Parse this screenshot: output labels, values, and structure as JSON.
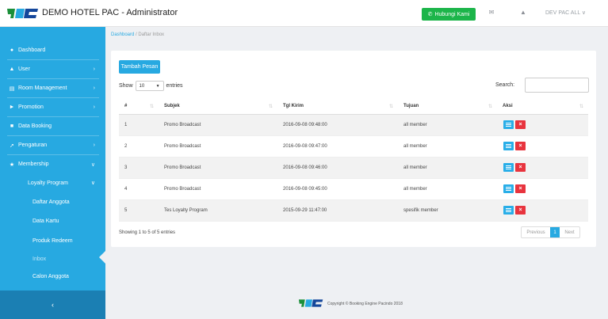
{
  "header": {
    "app_title": "DEMO HOTEL PAC - Administrator",
    "contact_label": "Hubungi Kami",
    "user_label": "DEV PAC ALL ∨"
  },
  "sidebar": {
    "items": [
      {
        "label": "Dashboard",
        "icon": "dashboard-icon",
        "chevron": ""
      },
      {
        "label": "User",
        "icon": "user-icon",
        "chevron": "›"
      },
      {
        "label": "Room Management",
        "icon": "room-icon",
        "chevron": "›"
      },
      {
        "label": "Promotion",
        "icon": "tag-icon",
        "chevron": "›"
      },
      {
        "label": "Data Booking",
        "icon": "booking-icon",
        "chevron": ""
      },
      {
        "label": "Pengaturan",
        "icon": "wrench-icon",
        "chevron": "›"
      },
      {
        "label": "Membership",
        "icon": "star-icon",
        "chevron": "∨"
      }
    ],
    "loyalty": {
      "label": "Loyalty Program",
      "chevron": "∨"
    },
    "sub_items": [
      {
        "label": "Daftar Anggota"
      },
      {
        "label": "Data Kartu"
      },
      {
        "label": "Produk Redeem"
      },
      {
        "label": "Inbox"
      },
      {
        "label": "Calon Anggota"
      }
    ],
    "collapse_glyph": "‹"
  },
  "breadcrumb": {
    "home": "Dashboard",
    "separator": "/",
    "current": "Daftar Inbox"
  },
  "panel": {
    "add_button": "Tambah Pesan",
    "show_label": "Show",
    "entries_value": "10",
    "entries_label": "entries",
    "search_label": "Search:",
    "columns": [
      "#",
      "Subjek",
      "Tgl Kirim",
      "Tujuan",
      "Aksi"
    ],
    "rows": [
      [
        "1",
        "Promo Broadcast",
        "2016-09-08 09:48:00",
        "all member"
      ],
      [
        "2",
        "Promo Broadcast",
        "2016-09-08 09:47:00",
        "all member"
      ],
      [
        "3",
        "Promo Broadcast",
        "2016-09-08 09:46:00",
        "all member"
      ],
      [
        "4",
        "Promo Broadcast",
        "2016-09-08 09:45:00",
        "all member"
      ],
      [
        "5",
        "Tes Loyalty Program",
        "2015-09-29 11:47:00",
        "spesifik member"
      ]
    ],
    "info": "Showing 1 to 5 of 5 entries",
    "pager": {
      "prev": "Previous",
      "current": "1",
      "next": "Next"
    }
  },
  "footer": {
    "text": "Copyright © Booking Engine Pacindo 2018"
  },
  "colors": {
    "sidebar": "#27a9e1",
    "success": "#1cb54a",
    "danger": "#e8343e",
    "accent": "#27a9e1"
  }
}
